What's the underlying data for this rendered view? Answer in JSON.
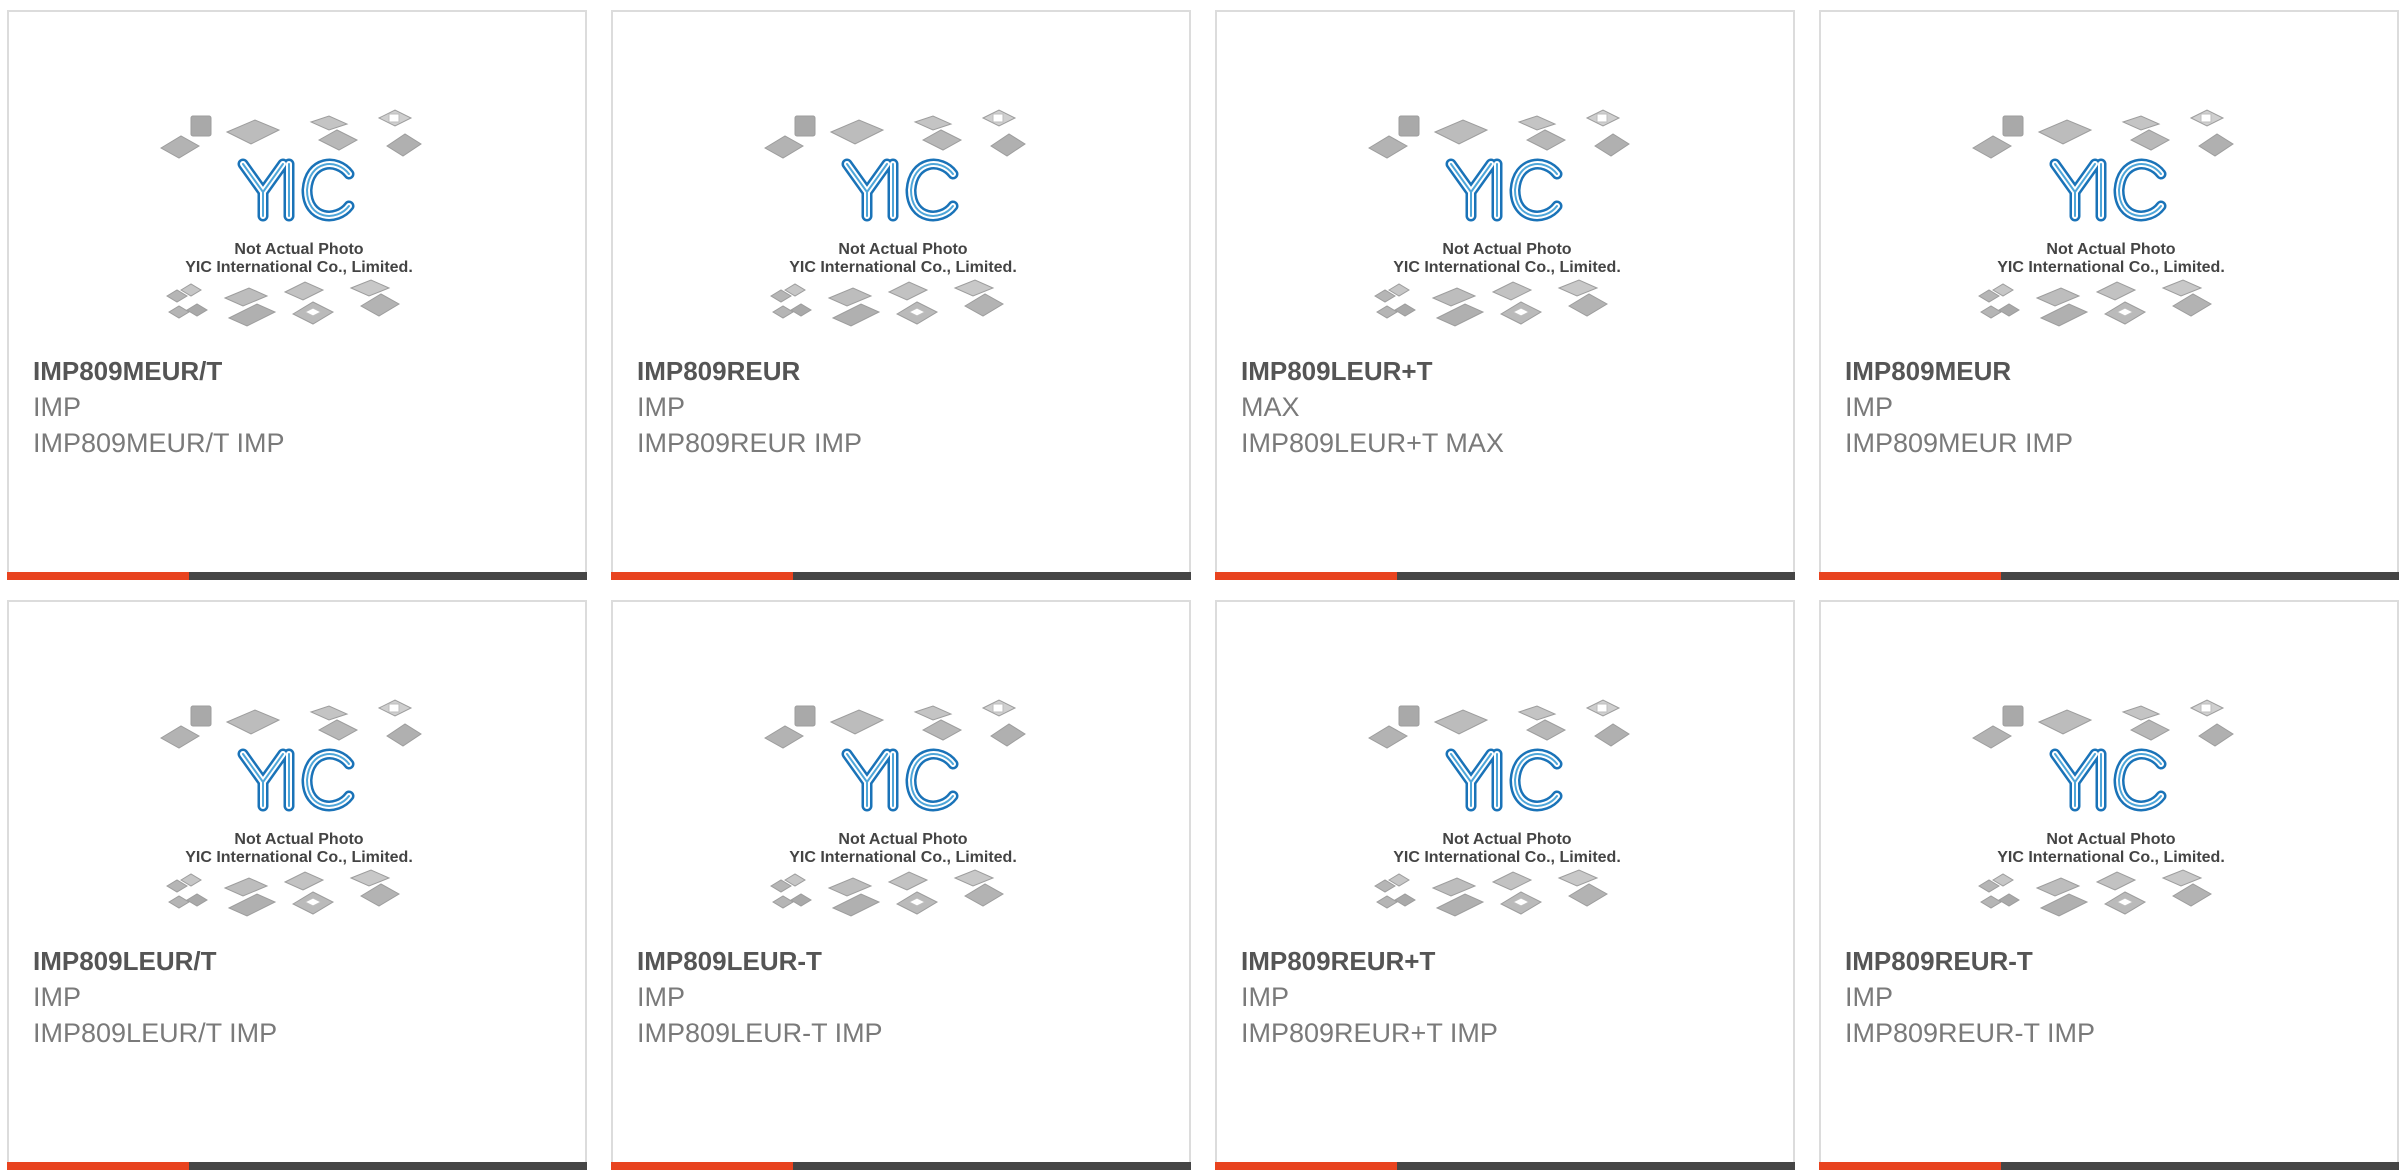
{
  "placeholder": {
    "line1": "Not Actual Photo",
    "line2": "YIC International Co., Limited.",
    "logo": "YIC",
    "logo_color": "#1a73b8"
  },
  "colors": {
    "accent": "#e8431f",
    "bar": "#454545",
    "part_text": "#555555",
    "meta_text": "#7a7a7a"
  },
  "products": [
    {
      "part": "IMP809MEUR/T",
      "maker": "IMP",
      "desc": "IMP809MEUR/T IMP"
    },
    {
      "part": "IMP809REUR",
      "maker": "IMP",
      "desc": "IMP809REUR IMP"
    },
    {
      "part": "IMP809LEUR+T",
      "maker": "MAX",
      "desc": "IMP809LEUR+T MAX"
    },
    {
      "part": "IMP809MEUR",
      "maker": "IMP",
      "desc": "IMP809MEUR IMP"
    },
    {
      "part": "IMP809LEUR/T",
      "maker": "IMP",
      "desc": "IMP809LEUR/T IMP"
    },
    {
      "part": "IMP809LEUR-T",
      "maker": "IMP",
      "desc": "IMP809LEUR-T IMP"
    },
    {
      "part": "IMP809REUR+T",
      "maker": "IMP",
      "desc": "IMP809REUR+T IMP"
    },
    {
      "part": "IMP809REUR-T",
      "maker": "IMP",
      "desc": "IMP809REUR-T IMP"
    }
  ]
}
